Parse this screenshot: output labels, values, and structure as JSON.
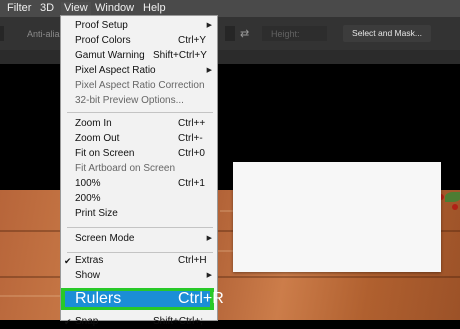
{
  "menubar": {
    "items": [
      {
        "label": "Filter"
      },
      {
        "label": "3D"
      },
      {
        "label": "View"
      },
      {
        "label": "Window"
      },
      {
        "label": "Help"
      }
    ]
  },
  "options_bar": {
    "anti_alias_label": "Anti-alias",
    "height_label": "Height:",
    "select_mask_label": "Select and Mask..."
  },
  "view_menu": {
    "items": [
      {
        "label": "Proof Setup",
        "shortcut": "",
        "submenu": true
      },
      {
        "label": "Proof Colors",
        "shortcut": "Ctrl+Y"
      },
      {
        "label": "Gamut Warning",
        "shortcut": "Shift+Ctrl+Y"
      },
      {
        "label": "Pixel Aspect Ratio",
        "shortcut": "",
        "submenu": true
      },
      {
        "label": "Pixel Aspect Ratio Correction",
        "shortcut": "",
        "disabled": true
      },
      {
        "label": "32-bit Preview Options...",
        "shortcut": "",
        "disabled": true
      },
      {
        "label": "Zoom In",
        "shortcut": "Ctrl++"
      },
      {
        "label": "Zoom Out",
        "shortcut": "Ctrl+-"
      },
      {
        "label": "Fit on Screen",
        "shortcut": "Ctrl+0"
      },
      {
        "label": "Fit Artboard on Screen",
        "shortcut": "",
        "disabled": true
      },
      {
        "label": "100%",
        "shortcut": "Ctrl+1"
      },
      {
        "label": "200%",
        "shortcut": ""
      },
      {
        "label": "Print Size",
        "shortcut": ""
      },
      {
        "label": "Screen Mode",
        "shortcut": "",
        "submenu": true
      },
      {
        "label": "Extras",
        "shortcut": "Ctrl+H",
        "checked": true
      },
      {
        "label": "Show",
        "shortcut": "",
        "submenu": true
      },
      {
        "label": "Rulers",
        "shortcut": "Ctrl+R",
        "selected": true
      },
      {
        "label": "Snap",
        "shortcut": "Shift+Ctrl+;",
        "checked": true
      }
    ]
  },
  "colors": {
    "menu_highlight": "#1b8ed6",
    "annotation_box": "#28c928"
  }
}
